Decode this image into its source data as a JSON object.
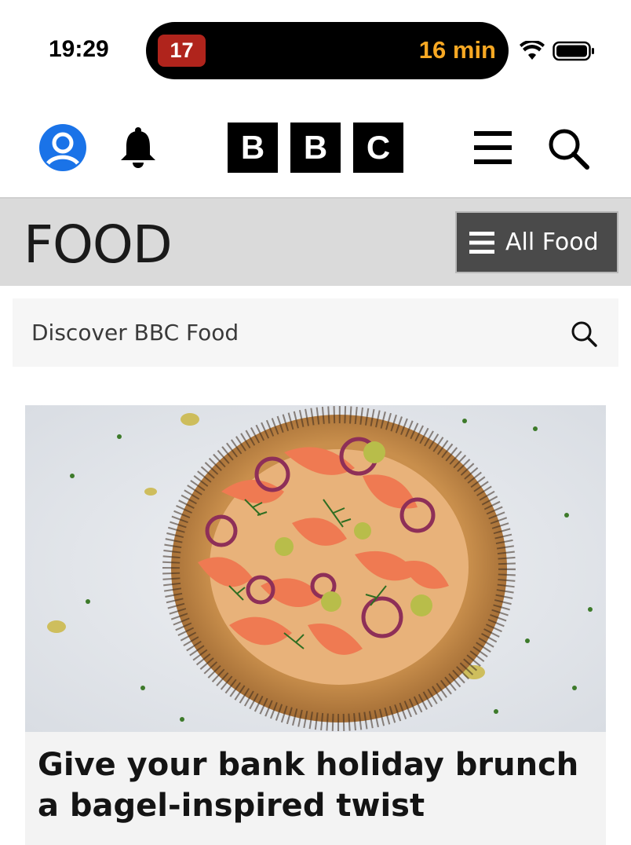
{
  "status_bar": {
    "time": "19:29",
    "island_badge": "17",
    "island_timer": "16 min",
    "badge_color": "#b0241c",
    "timer_color": "#f7a823",
    "icons": [
      "wifi-icon",
      "battery-icon"
    ]
  },
  "header": {
    "logo_letters": [
      "B",
      "B",
      "C"
    ],
    "icons": [
      "account-icon",
      "bell-icon",
      "menu-icon",
      "search-icon"
    ],
    "account_color": "#1a73e8"
  },
  "food_nav": {
    "title": "FOOD",
    "all_food_label": "All Food"
  },
  "search": {
    "placeholder": "Discover BBC Food"
  },
  "article": {
    "headline": "Give your bank holiday brunch a bagel-inspired twist",
    "image_subject": "pizza-style bagel tart with smoked salmon, red onion, capers, gherkins and dill"
  }
}
